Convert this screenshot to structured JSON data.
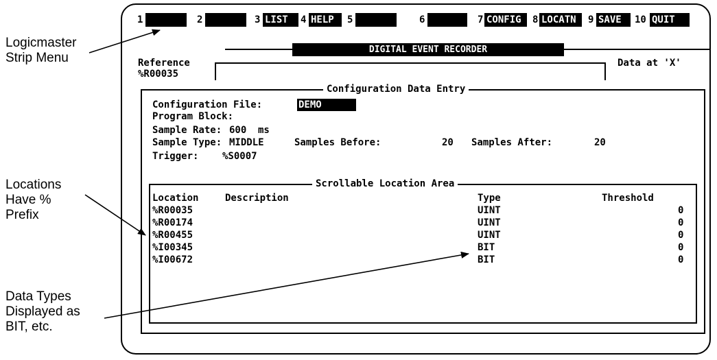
{
  "callouts": {
    "strip_menu": [
      "Logicmaster",
      "Strip Menu"
    ],
    "locations": [
      "Locations",
      "Have %",
      "Prefix"
    ],
    "data_types": [
      "Data Types",
      "Displayed as",
      "BIT, etc."
    ]
  },
  "strip_menu": [
    {
      "num": "1",
      "label": ""
    },
    {
      "num": "2",
      "label": ""
    },
    {
      "num": "3",
      "label": "LIST"
    },
    {
      "num": "4",
      "label": "HELP"
    },
    {
      "num": "5",
      "label": ""
    },
    {
      "num": "6",
      "label": ""
    },
    {
      "num": "7",
      "label": "CONFIG"
    },
    {
      "num": "8",
      "label": "LOCATN"
    },
    {
      "num": "9",
      "label": "SAVE"
    },
    {
      "num": "10",
      "label": "QUIT"
    }
  ],
  "title": "DIGITAL EVENT RECORDER",
  "reference": {
    "label": "Reference",
    "value": "%R00035"
  },
  "data_at": "Data at 'X'",
  "config_entry": {
    "legend": "Configuration Data Entry",
    "config_file_label": "Configuration File:",
    "config_file_value": "DEMO",
    "program_block_label": "Program Block:",
    "sample_rate_label": "Sample Rate:",
    "sample_rate_value": "600",
    "sample_rate_unit": "ms",
    "sample_type_label": "Sample Type:",
    "sample_type_value": "MIDDLE",
    "samples_before_label": "Samples Before:",
    "samples_before_value": "20",
    "samples_after_label": "Samples After:",
    "samples_after_value": "20",
    "trigger_label": "Trigger:",
    "trigger_value": "%S0007"
  },
  "location_area": {
    "legend": "Scrollable Location Area",
    "headers": {
      "location": "Location",
      "description": "Description",
      "type": "Type",
      "threshold": "Threshold"
    },
    "rows": [
      {
        "location": "%R00035",
        "type": "UINT",
        "threshold": "0"
      },
      {
        "location": "%R00174",
        "type": "UINT",
        "threshold": "0"
      },
      {
        "location": "%R00455",
        "type": "UINT",
        "threshold": "0"
      },
      {
        "location": "%I00345",
        "type": "BIT",
        "threshold": "0"
      },
      {
        "location": "%I00672",
        "type": "BIT",
        "threshold": "0"
      }
    ]
  }
}
